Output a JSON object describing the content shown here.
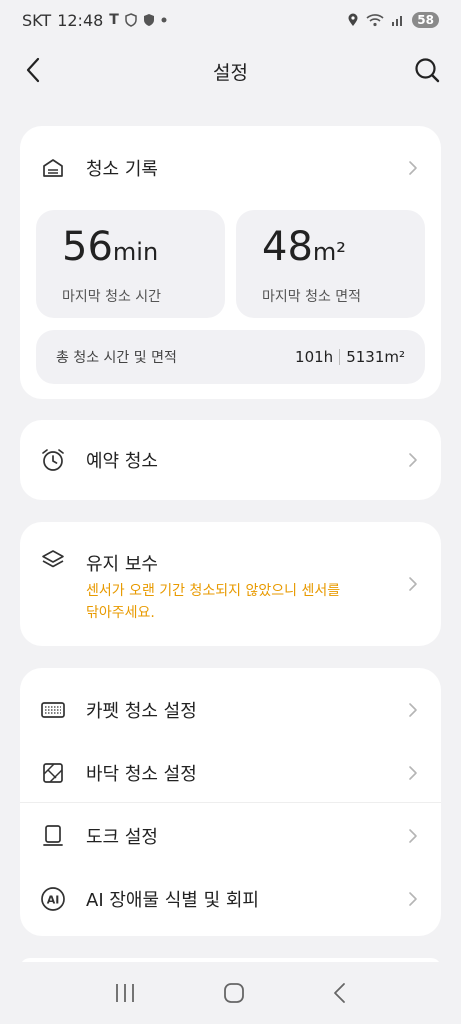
{
  "status_bar": {
    "carrier": "SKT",
    "time": "12:48",
    "battery": "58"
  },
  "header": {
    "title": "설정"
  },
  "cleaning_record": {
    "label": "청소 기록",
    "last_time_value": "56",
    "last_time_unit": "min",
    "last_time_caption": "마지막 청소 시간",
    "last_area_value": "48",
    "last_area_unit": "m²",
    "last_area_caption": "마지막 청소 면적",
    "total_label": "총 청소 시간 및 면적",
    "total_time": "101h",
    "total_area": "5131m²"
  },
  "schedule": {
    "label": "예약 청소"
  },
  "maintenance": {
    "label": "유지 보수",
    "warning": "센서가 오랜 기간 청소되지 않았으니 센서를",
    "warning_line2": "닦아주세요.",
    "warning_color": "#e89a00"
  },
  "settings_list": [
    {
      "label": "카펫 청소 설정",
      "icon": "carpet-icon"
    },
    {
      "label": "바닥 청소 설정",
      "icon": "floor-icon"
    },
    {
      "label": "도크 설정",
      "icon": "dock-icon"
    },
    {
      "label": "AI 장애물 식별 및 회피",
      "icon": "ai-icon"
    }
  ]
}
